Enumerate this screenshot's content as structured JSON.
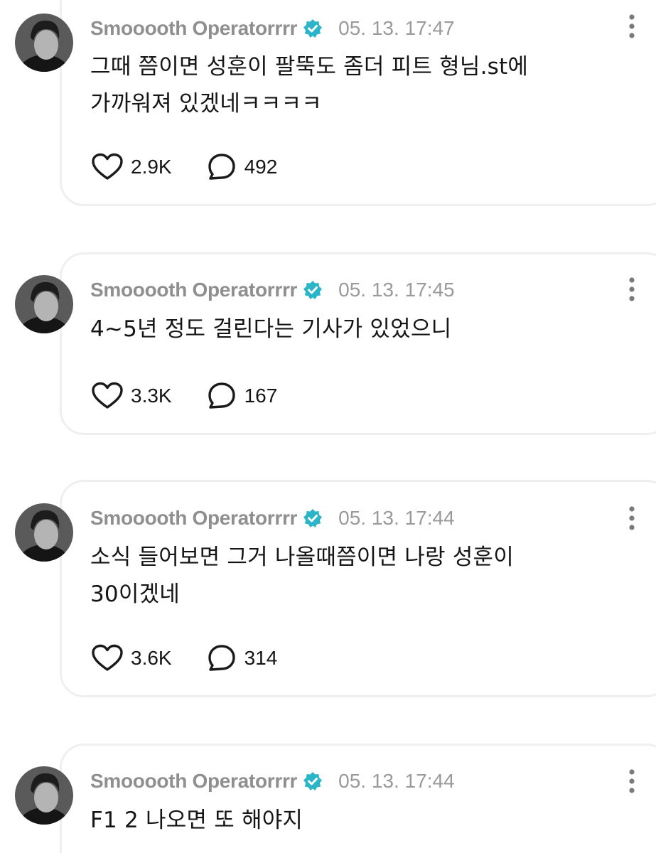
{
  "posts": [
    {
      "username": "Smooooth Operatorrrr",
      "timestamp": "05. 13. 17:47",
      "text_line1": "그때 쯤이면 성훈이 팔뚝도 좀더 피트 형님.st에",
      "text_line2": "가까워져 있겠네ㅋㅋㅋㅋ",
      "likes": "2.9K",
      "replies": "492"
    },
    {
      "username": "Smooooth Operatorrrr",
      "timestamp": "05. 13. 17:45",
      "text_line1": "4~5년 정도 걸린다는 기사가 있었으니",
      "text_line2": "",
      "likes": "3.3K",
      "replies": "167"
    },
    {
      "username": "Smooooth Operatorrrr",
      "timestamp": "05. 13. 17:44",
      "text_line1": "소식 들어보면 그거 나올때쯤이면 나랑 성훈이",
      "text_line2": "30이겠네",
      "likes": "3.6K",
      "replies": "314"
    },
    {
      "username": "Smooooth Operatorrrr",
      "timestamp": "05. 13. 17:44",
      "text_line1": "F1 2 나오면 또 해야지",
      "text_line2": ""
    }
  ],
  "icons": {
    "verified": "verified-badge-icon",
    "like": "heart-icon",
    "reply": "speech-bubble-icon",
    "more": "vertical-dots-icon",
    "avatar": "profile-avatar"
  },
  "colors": {
    "verified": "#2ab6c8",
    "username": "#8f8f8f",
    "card_border": "#efefef"
  }
}
